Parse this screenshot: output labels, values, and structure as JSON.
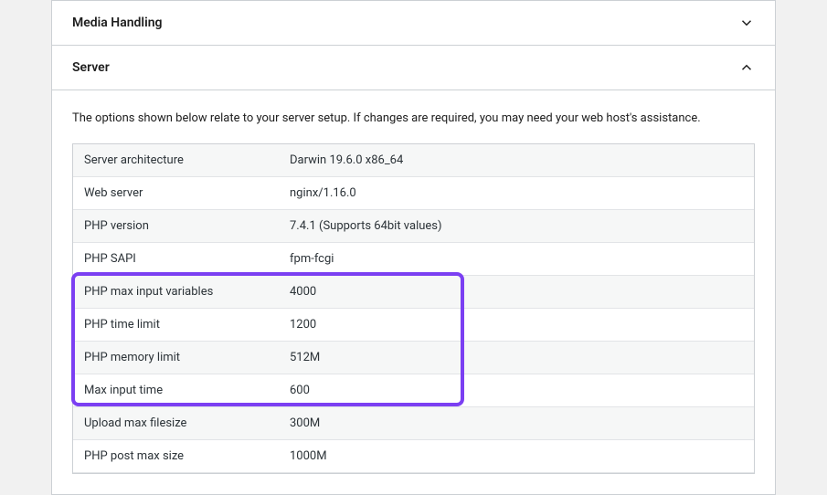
{
  "sections": {
    "media": {
      "title": "Media Handling"
    },
    "server": {
      "title": "Server",
      "description": "The options shown below relate to your server setup. If changes are required, you may need your web host's assistance.",
      "rows": [
        {
          "label": "Server architecture",
          "value": "Darwin 19.6.0 x86_64"
        },
        {
          "label": "Web server",
          "value": "nginx/1.16.0"
        },
        {
          "label": "PHP version",
          "value": "7.4.1 (Supports 64bit values)"
        },
        {
          "label": "PHP SAPI",
          "value": "fpm-fcgi"
        },
        {
          "label": "PHP max input variables",
          "value": "4000"
        },
        {
          "label": "PHP time limit",
          "value": "1200"
        },
        {
          "label": "PHP memory limit",
          "value": "512M"
        },
        {
          "label": "Max input time",
          "value": "600"
        },
        {
          "label": "Upload max filesize",
          "value": "300M"
        },
        {
          "label": "PHP post max size",
          "value": "1000M"
        }
      ]
    }
  }
}
